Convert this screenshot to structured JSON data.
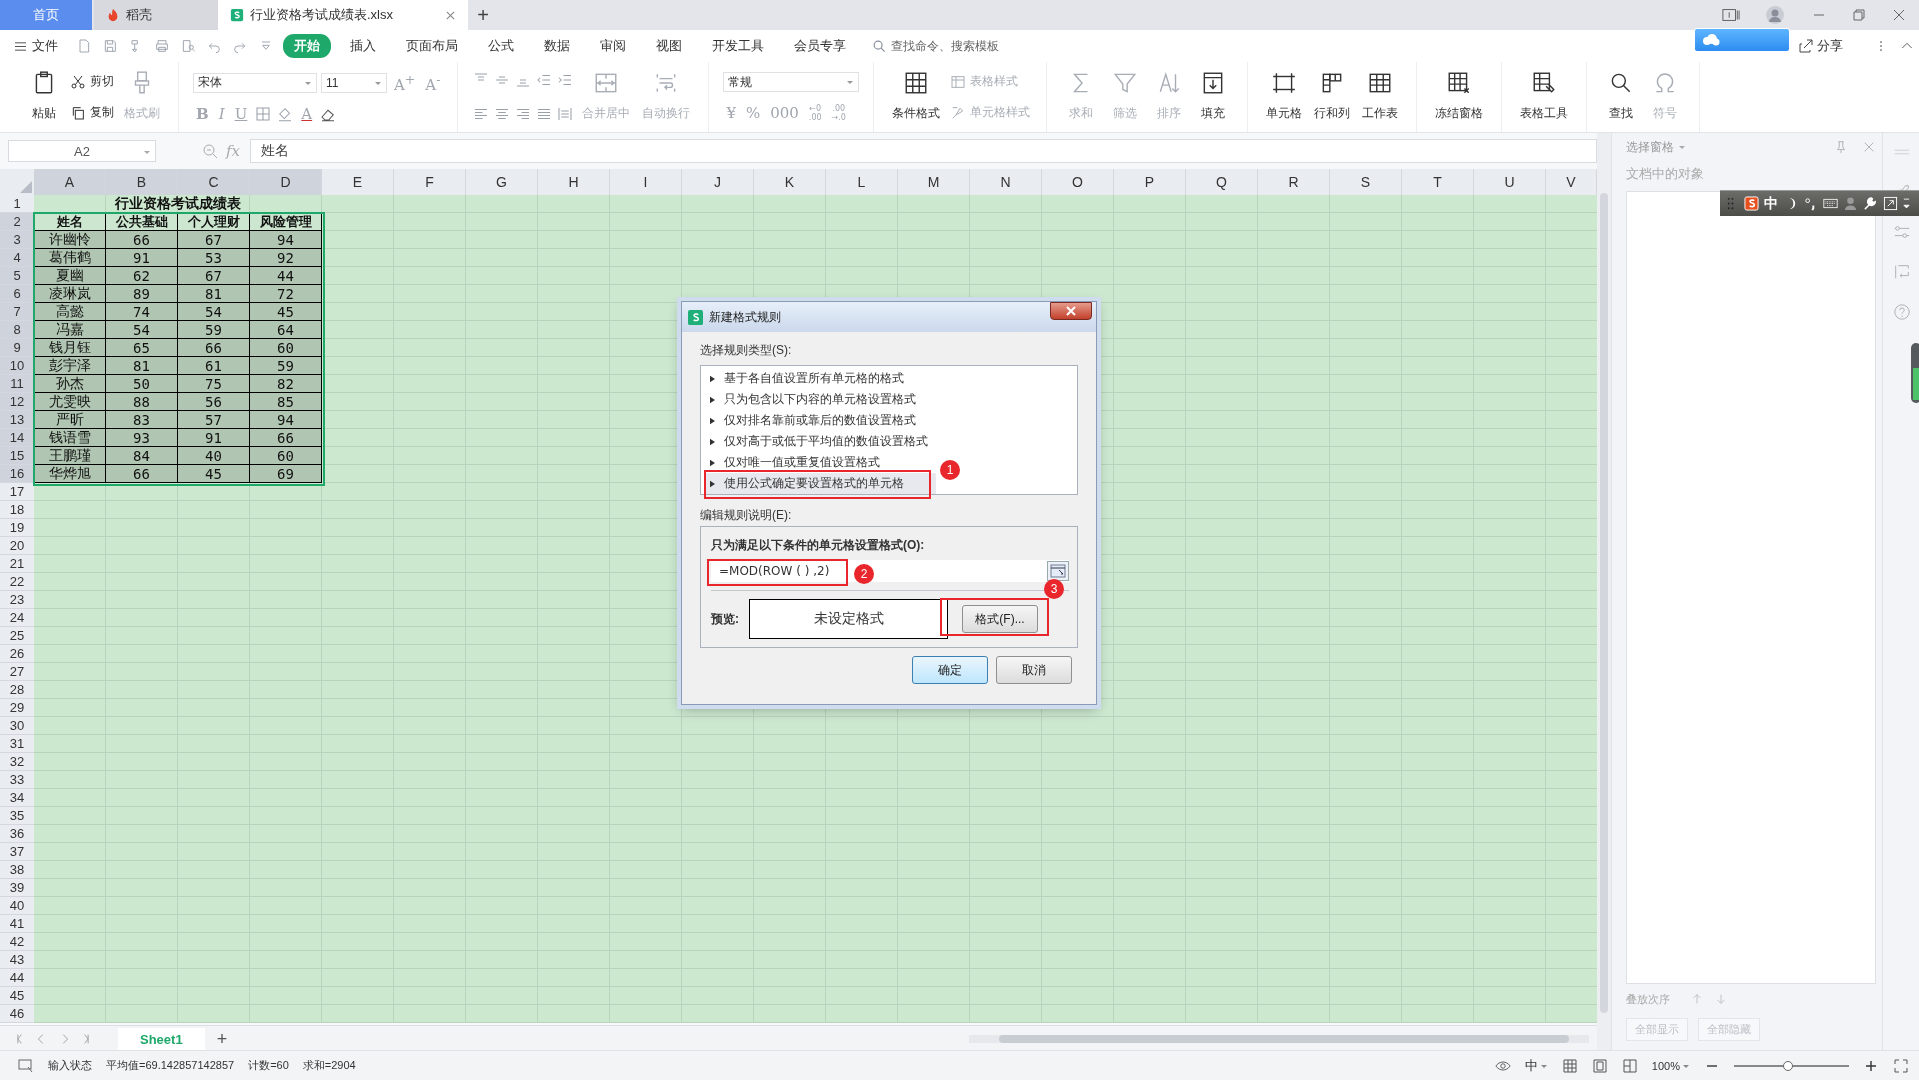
{
  "tabs": [
    {
      "label": "首页",
      "kind": "home",
      "selected": false
    },
    {
      "label": "稻壳",
      "kind": "docer",
      "selected": false
    },
    {
      "label": "行业资格考试成绩表.xlsx",
      "kind": "file",
      "selected": true
    }
  ],
  "new_tab": "+",
  "menu": {
    "file": "文件",
    "items": [
      {
        "label": "开始",
        "selected": true
      },
      {
        "label": "插入",
        "selected": false
      },
      {
        "label": "页面布局",
        "selected": false
      },
      {
        "label": "公式",
        "selected": false
      },
      {
        "label": "数据",
        "selected": false
      },
      {
        "label": "审阅",
        "selected": false
      },
      {
        "label": "视图",
        "selected": false
      },
      {
        "label": "开发工具",
        "selected": false
      },
      {
        "label": "会员专享",
        "selected": false
      }
    ],
    "search_placeholder": "查找命令、搜索模板",
    "share": "分享"
  },
  "ribbon": [
    {
      "kind": "buttons",
      "items": [
        {
          "kind": "large",
          "label": "粘贴",
          "disabled": false
        },
        {
          "kind": "stack",
          "items": [
            {
              "label": "剪切",
              "disabled": false
            },
            {
              "label": "复制",
              "disabled": false
            }
          ]
        },
        {
          "kind": "large",
          "label": "格式刷",
          "disabled": true
        }
      ]
    },
    {
      "kind": "font",
      "font": "宋体",
      "size": "11",
      "size_buttons": [
        "A$^{+}$",
        "A$^{-}$"
      ],
      "style_buttons": [
        "B",
        "I",
        "U"
      ],
      "color_button": "A"
    },
    {
      "kind": "align",
      "items": [
        {
          "kind": "large",
          "label": "合并居中",
          "disabled": true
        },
        {
          "kind": "large",
          "label": "自动换行",
          "disabled": true
        }
      ]
    },
    {
      "kind": "number",
      "format": "常规",
      "symbols": [
        "¥",
        "%",
        "000"
      ],
      "decimals": [
        {
          "top": "←0",
          "bottom": ".00"
        },
        {
          "top": ".00",
          "bottom": "→.0"
        }
      ]
    },
    {
      "kind": "buttons",
      "items": [
        {
          "kind": "large",
          "label": "条件格式",
          "disabled": false
        },
        {
          "kind": "stack",
          "items": [
            {
              "label": "表格样式",
              "disabled": true
            },
            {
              "label": "单元格样式",
              "disabled": true
            }
          ]
        }
      ]
    },
    {
      "kind": "buttons",
      "items": [
        {
          "kind": "large",
          "label": "求和",
          "disabled": true
        },
        {
          "kind": "large",
          "label": "筛选",
          "disabled": true
        },
        {
          "kind": "large",
          "label": "排序",
          "disabled": true
        },
        {
          "kind": "large",
          "label": "填充",
          "disabled": false
        }
      ]
    },
    {
      "kind": "buttons",
      "items": [
        {
          "kind": "large",
          "label": "单元格",
          "disabled": false
        },
        {
          "kind": "large",
          "label": "行和列",
          "disabled": false
        },
        {
          "kind": "large",
          "label": "工作表",
          "disabled": false
        }
      ]
    },
    {
      "kind": "buttons",
      "items": [
        {
          "kind": "large",
          "label": "冻结窗格",
          "disabled": false
        }
      ]
    },
    {
      "kind": "buttons",
      "items": [
        {
          "kind": "large",
          "label": "表格工具",
          "disabled": false
        }
      ]
    },
    {
      "kind": "buttons",
      "items": [
        {
          "kind": "large",
          "label": "查找",
          "disabled": false
        },
        {
          "kind": "large",
          "label": "符号",
          "disabled": true
        }
      ]
    }
  ],
  "formula_bar": {
    "name_box": "A2",
    "function_label": "fx",
    "value": "姓名"
  },
  "columns": [
    {
      "label": "A",
      "selected": true
    },
    {
      "label": "B",
      "selected": true
    },
    {
      "label": "C",
      "selected": true
    },
    {
      "label": "D",
      "selected": true
    },
    {
      "label": "E",
      "selected": false
    },
    {
      "label": "F",
      "selected": false
    },
    {
      "label": "G",
      "selected": false
    },
    {
      "label": "H",
      "selected": false
    },
    {
      "label": "I",
      "selected": false
    },
    {
      "label": "J",
      "selected": false
    },
    {
      "label": "K",
      "selected": false
    },
    {
      "label": "L",
      "selected": false
    },
    {
      "label": "M",
      "selected": false
    },
    {
      "label": "N",
      "selected": false
    },
    {
      "label": "O",
      "selected": false
    },
    {
      "label": "P",
      "selected": false
    },
    {
      "label": "Q",
      "selected": false
    },
    {
      "label": "R",
      "selected": false
    },
    {
      "label": "S",
      "selected": false
    },
    {
      "label": "T",
      "selected": false
    },
    {
      "label": "U",
      "selected": false
    },
    {
      "label": "V",
      "selected": false
    }
  ],
  "rows": [
    {
      "label": "1",
      "selected": false
    },
    {
      "label": "2",
      "selected": true
    },
    {
      "label": "3",
      "selected": true
    },
    {
      "label": "4",
      "selected": true
    },
    {
      "label": "5",
      "selected": true
    },
    {
      "label": "6",
      "selected": true
    },
    {
      "label": "7",
      "selected": true
    },
    {
      "label": "8",
      "selected": true
    },
    {
      "label": "9",
      "selected": true
    },
    {
      "label": "10",
      "selected": true
    },
    {
      "label": "11",
      "selected": true
    },
    {
      "label": "12",
      "selected": true
    },
    {
      "label": "13",
      "selected": true
    },
    {
      "label": "14",
      "selected": true
    },
    {
      "label": "15",
      "selected": true
    },
    {
      "label": "16",
      "selected": true
    },
    {
      "label": "17",
      "selected": false
    },
    {
      "label": "18",
      "selected": false
    },
    {
      "label": "19",
      "selected": false
    },
    {
      "label": "20",
      "selected": false
    },
    {
      "label": "21",
      "selected": false
    },
    {
      "label": "22",
      "selected": false
    },
    {
      "label": "23",
      "selected": false
    },
    {
      "label": "24",
      "selected": false
    },
    {
      "label": "25",
      "selected": false
    },
    {
      "label": "26",
      "selected": false
    },
    {
      "label": "27",
      "selected": false
    },
    {
      "label": "28",
      "selected": false
    },
    {
      "label": "29",
      "selected": false
    },
    {
      "label": "30",
      "selected": false
    },
    {
      "label": "31",
      "selected": false
    },
    {
      "label": "32",
      "selected": false
    },
    {
      "label": "33",
      "selected": false
    },
    {
      "label": "34",
      "selected": false
    },
    {
      "label": "35",
      "selected": false
    },
    {
      "label": "36",
      "selected": false
    },
    {
      "label": "37",
      "selected": false
    },
    {
      "label": "38",
      "selected": false
    },
    {
      "label": "39",
      "selected": false
    },
    {
      "label": "40",
      "selected": false
    },
    {
      "label": "41",
      "selected": false
    },
    {
      "label": "42",
      "selected": false
    },
    {
      "label": "43",
      "selected": false
    },
    {
      "label": "44",
      "selected": false
    },
    {
      "label": "45",
      "selected": false
    },
    {
      "label": "46",
      "selected": false
    }
  ],
  "sheet": {
    "title": "行业资格考试成绩表",
    "headers": [
      "姓名",
      "公共基础",
      "个人理财",
      "风险管理"
    ],
    "records": [
      [
        "许幽怜",
        "66",
        "67",
        "94"
      ],
      [
        "葛伟鹤",
        "91",
        "53",
        "92"
      ],
      [
        "夏幽",
        "62",
        "67",
        "44"
      ],
      [
        "凌琳岚",
        "89",
        "81",
        "72"
      ],
      [
        "高懿",
        "74",
        "54",
        "45"
      ],
      [
        "冯嘉",
        "54",
        "59",
        "64"
      ],
      [
        "钱月钰",
        "65",
        "66",
        "60"
      ],
      [
        "彭宇泽",
        "81",
        "61",
        "59"
      ],
      [
        "孙杰",
        "50",
        "75",
        "82"
      ],
      [
        "尤雯映",
        "88",
        "56",
        "85"
      ],
      [
        "严昕",
        "83",
        "57",
        "94"
      ],
      [
        "钱语雪",
        "93",
        "91",
        "66"
      ],
      [
        "王鹏瑾",
        "84",
        "40",
        "60"
      ],
      [
        "华烨旭",
        "66",
        "45",
        "69"
      ]
    ]
  },
  "sheet_tabs": [
    {
      "label": "Sheet1",
      "selected": true
    }
  ],
  "add_sheet": "+",
  "dialog": {
    "title": "新建格式规则",
    "type_label": "选择规则类型(S):",
    "rule_types": [
      {
        "label": "基于各自值设置所有单元格的格式",
        "selected": false
      },
      {
        "label": "只为包含以下内容的单元格设置格式",
        "selected": false
      },
      {
        "label": "仅对排名靠前或靠后的数值设置格式",
        "selected": false
      },
      {
        "label": "仅对高于或低于平均值的数值设置格式",
        "selected": false
      },
      {
        "label": "仅对唯一值或重复值设置格式",
        "selected": false
      },
      {
        "label": "使用公式确定要设置格式的单元格",
        "selected": true
      }
    ],
    "edit_label": "编辑规则说明(E):",
    "condition_label": "只为满足以下条件的单元格设置格式(O):",
    "formula": "=MOD(ROW ( ) ,2)",
    "preview_label": "预览:",
    "preview_text": "未设定格式",
    "format_button": "格式(F)...",
    "ok": "确定",
    "cancel": "取消",
    "annotations": [
      {
        "label": "1"
      },
      {
        "label": "2"
      },
      {
        "label": "3"
      }
    ]
  },
  "side_panel": {
    "title": "选择窗格",
    "subtitle": "文档中的对象",
    "order_label": "叠放次序",
    "buttons": [
      {
        "label": "全部显示",
        "disabled": true
      },
      {
        "label": "全部隐藏",
        "disabled": true
      }
    ]
  },
  "ime": {
    "mode": "中"
  },
  "status": {
    "mode": "输入状态",
    "stats": [
      "平均值=69.142857142857",
      "计数=60",
      "求和=2904"
    ],
    "input_mode": "中",
    "zoom": "100%",
    "zoom_slider": {
      "level": 0.47
    }
  }
}
